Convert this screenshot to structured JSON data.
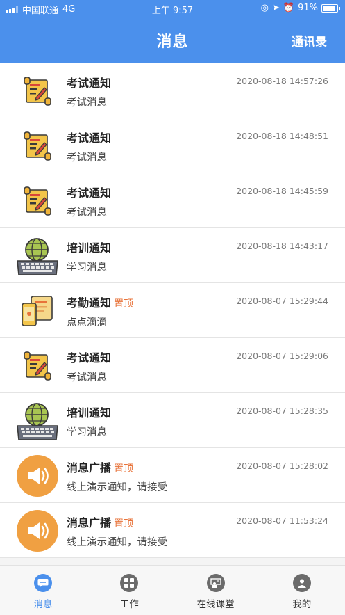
{
  "status_bar": {
    "carrier": "中国联通",
    "network": "4G",
    "time": "上午 9:57",
    "battery": "91%"
  },
  "header": {
    "title": "消息",
    "contacts_label": "通讯录"
  },
  "messages": [
    {
      "title": "考试通知",
      "pin": "",
      "time": "2020-08-18 14:57:26",
      "subtitle": "考试消息",
      "icon": "exam-scroll-icon"
    },
    {
      "title": "考试通知",
      "pin": "",
      "time": "2020-08-18 14:48:51",
      "subtitle": "考试消息",
      "icon": "exam-scroll-icon"
    },
    {
      "title": "考试通知",
      "pin": "",
      "time": "2020-08-18 14:45:59",
      "subtitle": "考试消息",
      "icon": "exam-scroll-icon"
    },
    {
      "title": "培训通知",
      "pin": "",
      "time": "2020-08-18 14:43:17",
      "subtitle": "学习消息",
      "icon": "globe-keyboard-icon"
    },
    {
      "title": "考勤通知",
      "pin": "置顶",
      "time": "2020-08-07 15:29:44",
      "subtitle": "点点滴滴",
      "icon": "phone-document-icon"
    },
    {
      "title": "考试通知",
      "pin": "",
      "time": "2020-08-07 15:29:06",
      "subtitle": "考试消息",
      "icon": "exam-scroll-icon"
    },
    {
      "title": "培训通知",
      "pin": "",
      "time": "2020-08-07 15:28:35",
      "subtitle": "学习消息",
      "icon": "globe-keyboard-icon"
    },
    {
      "title": "消息广播",
      "pin": "置顶",
      "time": "2020-08-07 15:28:02",
      "subtitle": "线上演示通知，请接受",
      "icon": "megaphone-icon"
    },
    {
      "title": "消息广播",
      "pin": "置顶",
      "time": "2020-08-07 11:53:24",
      "subtitle": "线上演示通知，请接受",
      "icon": "megaphone-icon"
    }
  ],
  "tabs": [
    {
      "label": "消息",
      "icon": "chat-bubble-icon",
      "active": true
    },
    {
      "label": "工作",
      "icon": "grid-icon",
      "active": false
    },
    {
      "label": "在线课堂",
      "icon": "classroom-icon",
      "active": false
    },
    {
      "label": "我的",
      "icon": "person-icon",
      "active": false
    }
  ],
  "colors": {
    "accent": "#4b90ec",
    "pin": "#e8733a",
    "megaphone": "#f0a042"
  }
}
